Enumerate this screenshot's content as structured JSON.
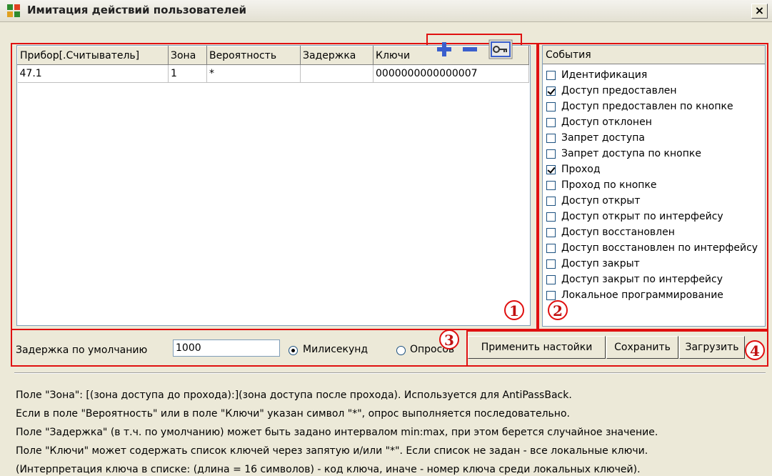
{
  "window": {
    "title": "Имитация действий пользователей",
    "close_label": "×"
  },
  "table": {
    "columns": [
      "Прибор[.Считыватель]",
      "Зона",
      "Вероятность",
      "Задержка",
      "Ключи"
    ],
    "rows": [
      {
        "device": "47.1",
        "zone": "1",
        "probability": "*",
        "delay": "",
        "keys": "0000000000000007"
      }
    ]
  },
  "toolbar": {
    "add_icon": "plus-icon",
    "remove_icon": "minus-icon",
    "keys_icon": "key-icon"
  },
  "events": {
    "header": "События",
    "items": [
      {
        "label": "Идентификация",
        "checked": false
      },
      {
        "label": "Доступ предоставлен",
        "checked": true
      },
      {
        "label": "Доступ предоставлен по кнопке",
        "checked": false
      },
      {
        "label": "Доступ отклонен",
        "checked": false
      },
      {
        "label": "Запрет доступа",
        "checked": false
      },
      {
        "label": "Запрет доступа по кнопке",
        "checked": false
      },
      {
        "label": "Проход",
        "checked": true
      },
      {
        "label": "Проход по кнопке",
        "checked": false
      },
      {
        "label": "Доступ открыт",
        "checked": false
      },
      {
        "label": "Доступ открыт по интерфейсу",
        "checked": false
      },
      {
        "label": "Доступ восстановлен",
        "checked": false
      },
      {
        "label": "Доступ восстановлен по интерфейсу",
        "checked": false
      },
      {
        "label": "Доступ закрыт",
        "checked": false
      },
      {
        "label": "Доступ закрыт по интерфейсу",
        "checked": false
      },
      {
        "label": "Локальное программирование",
        "checked": false
      }
    ]
  },
  "delay": {
    "label": "Задержка по умолчанию",
    "value": "1000",
    "unit_ms": "Милисекунд",
    "unit_polls": "Опросов",
    "selected": "ms"
  },
  "buttons": {
    "apply": "Применить настойки",
    "save": "Сохранить",
    "load": "Загрузить"
  },
  "markers": [
    "1",
    "2",
    "3",
    "4"
  ],
  "help": [
    "Поле \"Зона\": [(зона доступа до прохода):](зона доступа после прохода). Используется для AntiPassBack.",
    "Если в поле \"Вероятность\" или в поле \"Ключи\" указан символ \"*\", опрос выполняется последовательно.",
    "Поле \"Задержка\" (в т.ч. по умолчанию) может быть задано интервалом min:max, при этом берется случайное значение.",
    "Поле \"Ключи\" может содержать список ключей через запятую и/или \"*\". Если список не задан - все локальные ключи.",
    "(Интерпретация ключа в списке: (длина = 16 символов) - код ключа, иначе - номер ключа среди локальных ключей)."
  ],
  "colors": {
    "annotation": "#e01010",
    "toolbar_icon": "#3a5fcd",
    "background": "#ece9d8"
  }
}
